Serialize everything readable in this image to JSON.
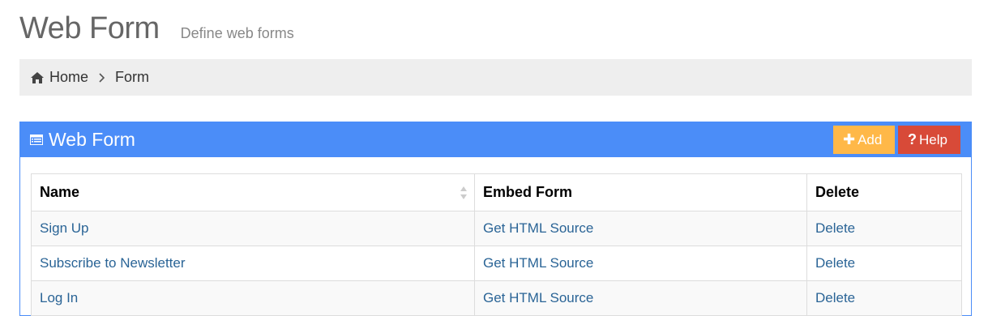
{
  "header": {
    "title": "Web Form",
    "subtitle": "Define web forms"
  },
  "breadcrumb": {
    "home_icon": "home-icon",
    "home_label": "Home",
    "separator_icon": "chevron-right-icon",
    "current_label": "Form"
  },
  "panel": {
    "title": "Web Form",
    "title_icon": "list-icon",
    "add_button": {
      "icon": "plus-icon",
      "label": "Add"
    },
    "help_button": {
      "icon": "question-icon",
      "label": "Help"
    }
  },
  "table": {
    "columns": [
      "Name",
      "Embed Form",
      "Delete"
    ],
    "rows": [
      {
        "name": "Sign Up",
        "embed": "Get HTML Source",
        "delete": "Delete"
      },
      {
        "name": "Subscribe to Newsletter",
        "embed": "Get HTML Source",
        "delete": "Delete"
      },
      {
        "name": "Log In",
        "embed": "Get HTML Source",
        "delete": "Delete"
      }
    ]
  },
  "colors": {
    "panel_blue": "#4b8df8",
    "add_orange": "#ffb848",
    "help_red": "#d84a38",
    "link_blue": "#2a6496",
    "breadcrumb_bg": "#eeeeee"
  }
}
